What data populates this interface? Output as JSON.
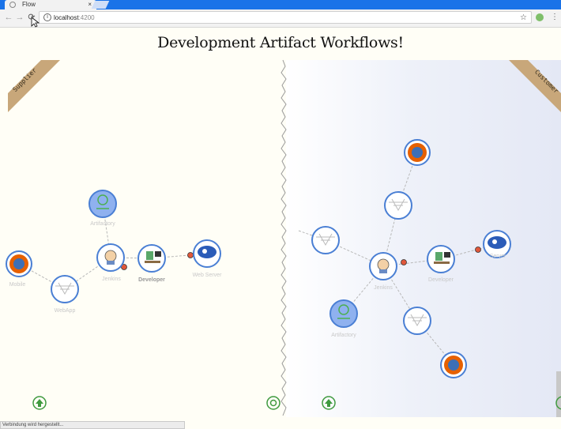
{
  "browser": {
    "tab_title": "Flow",
    "tab_close": "×",
    "url_host": "localhost",
    "url_port": ":4200",
    "nav": {
      "back": "←",
      "forward": "→",
      "reload": "⟳"
    },
    "menu": "⋮",
    "star": "☆"
  },
  "page": {
    "title": "Development Artifact Workflows!",
    "status_text": "Verbindung wird hergestellt..."
  },
  "left_panel": {
    "banner": "Supplier",
    "nodes": {
      "artifactory": "Artifactory",
      "jenkins": "Jenkins",
      "developer": "Developer",
      "mobile": "Mobile",
      "webapp": "WebApp",
      "web_server": "Web Server"
    }
  },
  "right_panel": {
    "banner": "Customer",
    "nodes": {
      "jenkins": "Jenkins",
      "artifactory": "Artifactory",
      "developer": "Developer",
      "server": "Server"
    }
  },
  "colors": {
    "tabstrip": "#1a73e8",
    "banner": "#c8a77a",
    "node_ring": "#4a7fd4",
    "artifactory_fill": "#8fb1ef",
    "connector_dot": "#e0573a",
    "footer_icon": "#3f9a3f"
  }
}
